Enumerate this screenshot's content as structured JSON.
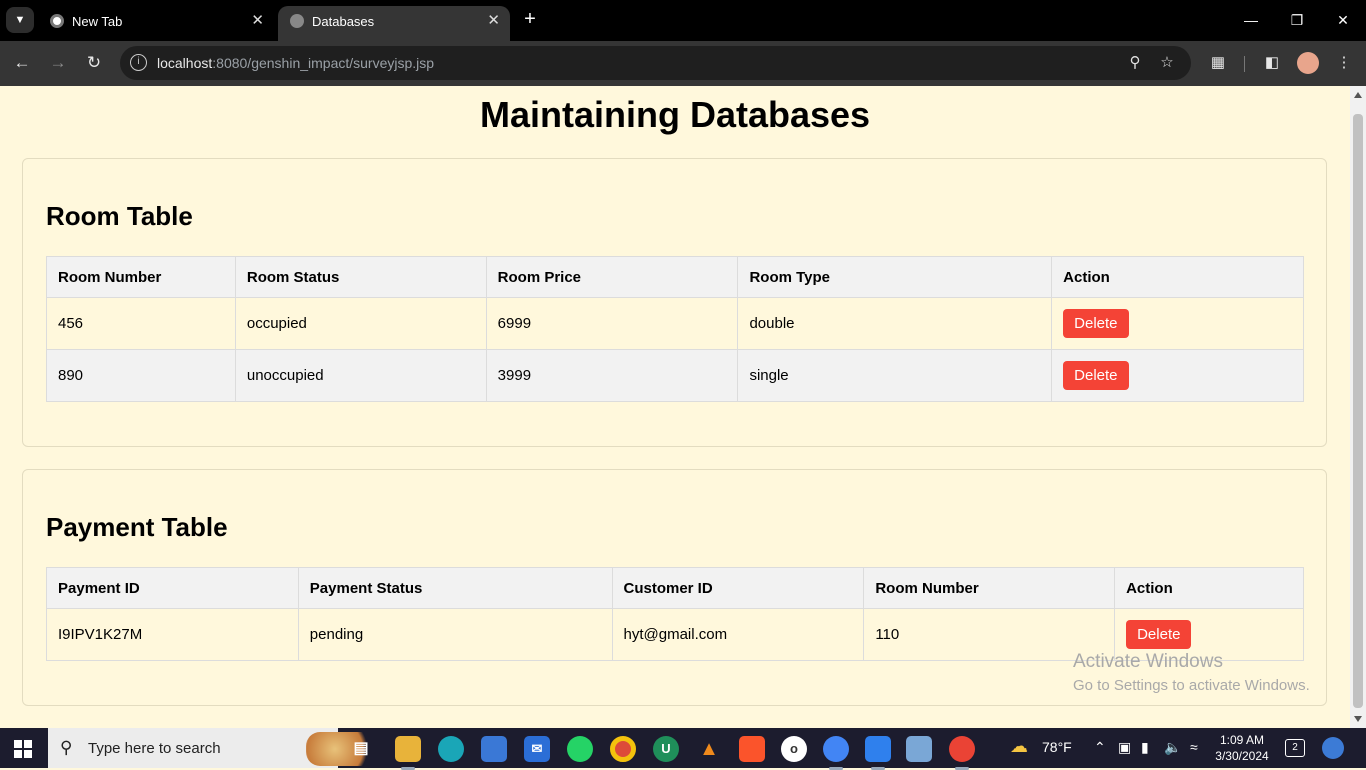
{
  "browser": {
    "tabs": [
      {
        "title": "New Tab",
        "active": false
      },
      {
        "title": "Databases",
        "active": true
      }
    ],
    "url_host": "localhost",
    "url_rest": ":8080/genshin_impact/surveyjsp.jsp"
  },
  "page": {
    "title": "Maintaining Databases",
    "room_table": {
      "heading": "Room Table",
      "columns": [
        "Room Number",
        "Room Status",
        "Room Price",
        "Room Type",
        "Action"
      ],
      "rows": [
        {
          "room_number": "456",
          "room_status": "occupied",
          "room_price": "6999",
          "room_type": "double",
          "action": "Delete"
        },
        {
          "room_number": "890",
          "room_status": "unoccupied",
          "room_price": "3999",
          "room_type": "single",
          "action": "Delete"
        }
      ]
    },
    "payment_table": {
      "heading": "Payment Table",
      "columns": [
        "Payment ID",
        "Payment Status",
        "Customer ID",
        "Room Number",
        "Action"
      ],
      "rows": [
        {
          "payment_id": "I9IPV1K27M",
          "payment_status": "pending",
          "customer_id": "hyt@gmail.com",
          "room_number": "110",
          "action": "Delete"
        }
      ]
    }
  },
  "watermark": {
    "line1": "Activate Windows",
    "line2": "Go to Settings to activate Windows."
  },
  "taskbar": {
    "search_placeholder": "Type here to search",
    "weather": "78°F",
    "time": "1:09 AM",
    "date": "3/30/2024",
    "notifications": "2"
  },
  "colors": {
    "page_bg": "#fff8dc",
    "delete_button": "#f44336",
    "header_row": "#f2f2f2"
  }
}
